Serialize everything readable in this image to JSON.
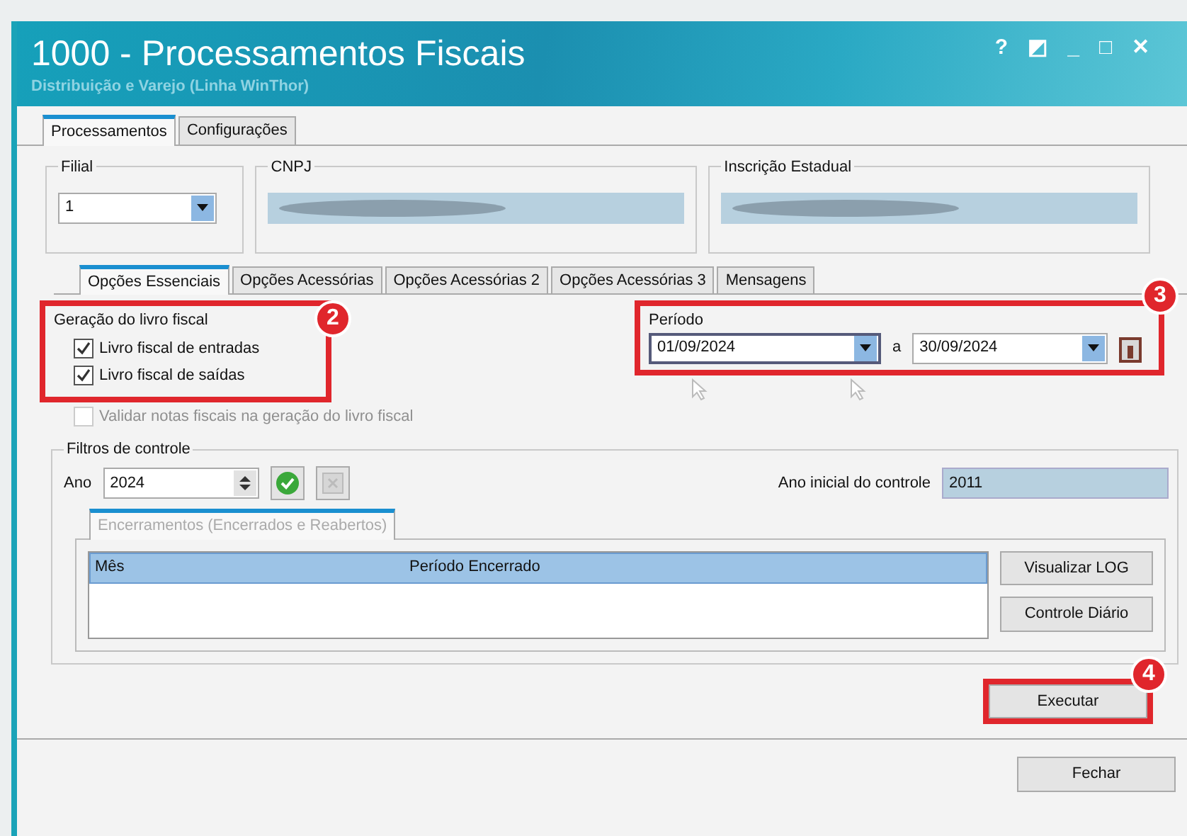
{
  "window": {
    "title": "1000 - Processamentos Fiscais",
    "subtitle": "Distribuição e Varejo (Linha WinThor)",
    "controls": [
      "?",
      "◩",
      "_",
      "□",
      "✕"
    ]
  },
  "main_tabs": [
    {
      "label": "Processamentos",
      "selected": true
    },
    {
      "label": "Configurações",
      "selected": false
    }
  ],
  "header_fields": [
    {
      "label": "Filial",
      "kind": "combo",
      "value": "1"
    },
    {
      "label": "CNPJ",
      "kind": "redacted"
    },
    {
      "label": "Inscrição Estadual",
      "kind": "redacted"
    }
  ],
  "option_tabs": [
    {
      "label": "Opções Essenciais",
      "selected": true
    },
    {
      "label": "Opções Acessórias",
      "selected": false
    },
    {
      "label": "Opções Acessórias 2",
      "selected": false
    },
    {
      "label": "Opções Acessórias 3",
      "selected": false
    },
    {
      "label": "Mensagens",
      "selected": false
    }
  ],
  "book_generation": {
    "title": "Geração do livro fiscal",
    "annotation": "2",
    "options": [
      {
        "label": "Livro fiscal de entradas",
        "checked": true,
        "disabled": false
      },
      {
        "label": "Livro fiscal de saídas",
        "checked": true,
        "disabled": false
      }
    ]
  },
  "validation_option": {
    "label": "Validar notas fiscais na geração do livro fiscal",
    "checked": false,
    "disabled": true
  },
  "period": {
    "title": "Período",
    "annotation": "3",
    "start": "01/09/2024",
    "separator": "a",
    "end": "30/09/2024"
  },
  "control_filters": {
    "title": "Filtros de controle",
    "year_label": "Ano",
    "year": "2024",
    "initial_year_label": "Ano inicial do controle",
    "initial_year": "2011"
  },
  "closings_tab": {
    "label": "Encerramentos (Encerrados e Reabertos)",
    "selected": true
  },
  "closings_table": {
    "columns": [
      "Mês",
      "Período Encerrado"
    ]
  },
  "side_buttons": [
    "Visualizar LOG",
    "Controle Diário"
  ],
  "execute_button": {
    "label": "Executar",
    "annotation": "4"
  },
  "close_button": {
    "label": "Fechar"
  }
}
